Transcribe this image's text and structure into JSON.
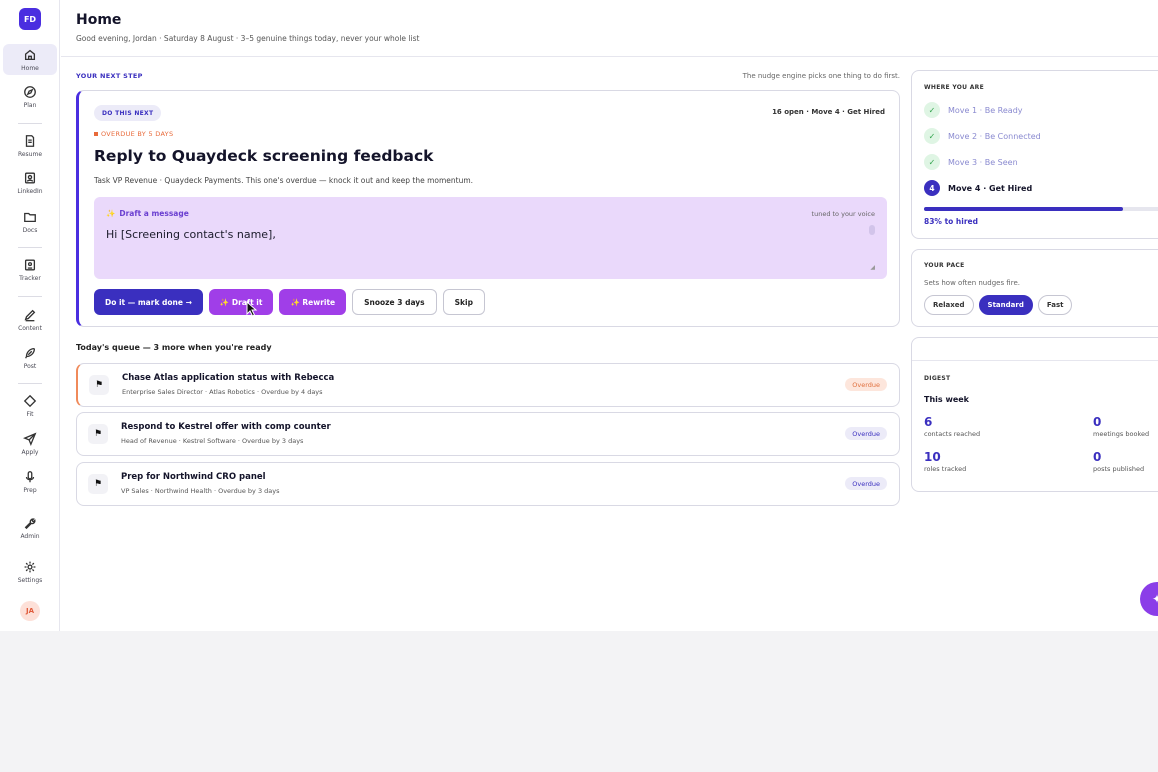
{
  "sidebar": {
    "logo": "FD",
    "items": [
      {
        "label": "Home",
        "icon": "home-icon"
      },
      {
        "label": "Plan",
        "icon": "compass-icon"
      },
      {
        "label": "Resume",
        "icon": "document-icon"
      },
      {
        "label": "LinkedIn",
        "icon": "profile-card-icon"
      },
      {
        "label": "Docs",
        "icon": "folder-icon"
      },
      {
        "label": "Tracker",
        "icon": "id-badge-icon"
      },
      {
        "label": "Content",
        "icon": "pen-icon"
      },
      {
        "label": "Post",
        "icon": "feather-icon"
      },
      {
        "label": "Fit",
        "icon": "diamond-icon"
      },
      {
        "label": "Apply",
        "icon": "send-icon"
      },
      {
        "label": "Prep",
        "icon": "microphone-icon"
      },
      {
        "label": "Admin",
        "icon": "wrench-icon"
      },
      {
        "label": "Settings",
        "icon": "gear-icon"
      }
    ],
    "avatar": "JA"
  },
  "header": {
    "title": "Home",
    "subtitle": "Good evening, Jordan · Saturday 8 August · 3–5 genuine things today, never your whole list"
  },
  "next_step": {
    "section_label": "YOUR NEXT STEP",
    "section_note": "The nudge engine picks one thing to do first.",
    "pill": "DO THIS NEXT",
    "meta": "16 open · Move 4 · Get Hired",
    "overdue": "OVERDUE BY 5 DAYS",
    "title": "Reply to Quaydeck screening feedback",
    "description": "Task VP Revenue · Quaydeck Payments. This one's overdue — knock it out and keep the momentum.",
    "draft": {
      "label": "Draft a message",
      "tuned": "tuned to your voice",
      "text": "Hi [Screening contact's name],"
    },
    "buttons": {
      "mark_done": "Do it — mark done →",
      "draft_it": "✨ Draft it",
      "rewrite": "✨ Rewrite",
      "snooze": "Snooze 3 days",
      "skip": "Skip"
    }
  },
  "queue": {
    "title": "Today's queue — 3 more when you're ready",
    "items": [
      {
        "title": "Chase Atlas application status with Rebecca",
        "sub": "Enterprise Sales Director · Atlas Robotics · Overdue by 4 days",
        "badge": "Overdue",
        "badge_color": "#e0703e"
      },
      {
        "title": "Respond to Kestrel offer with comp counter",
        "sub": "Head of Revenue · Kestrel Software · Overdue by 3 days",
        "badge": "Overdue",
        "badge_color": "#3a2fbf"
      },
      {
        "title": "Prep for Northwind CRO panel",
        "sub": "VP Sales · Northwind Health · Overdue by 3 days",
        "badge": "Overdue",
        "badge_color": "#3a2fbf"
      }
    ]
  },
  "where": {
    "label": "WHERE YOU ARE",
    "moves": [
      {
        "text": "Move 1 · Be Ready",
        "state": "done"
      },
      {
        "text": "Move 2 · Be Connected",
        "state": "done"
      },
      {
        "text": "Move 3 · Be Seen",
        "state": "done"
      },
      {
        "text": "Move 4 · Get Hired",
        "state": "current",
        "num": "4"
      }
    ],
    "progress_fraction": 0.83,
    "progress_label": "83% to hired"
  },
  "pace": {
    "label": "YOUR PACE",
    "sub": "Sets how often nudges fire.",
    "options": [
      "Relaxed",
      "Standard",
      "Fast"
    ],
    "selected": "Standard"
  },
  "digest": {
    "label": "DIGEST",
    "week": "This week",
    "stats": [
      {
        "value": "6",
        "label": "contacts reached"
      },
      {
        "value": "0",
        "label": "meetings booked"
      },
      {
        "value": "10",
        "label": "roles tracked"
      },
      {
        "value": "0",
        "label": "posts published"
      }
    ]
  },
  "colors": {
    "accent": "#3a2fbf",
    "brand": "#4a2ee0",
    "draft_bg": "#ead9fb",
    "overdue": "#e86a3a"
  }
}
